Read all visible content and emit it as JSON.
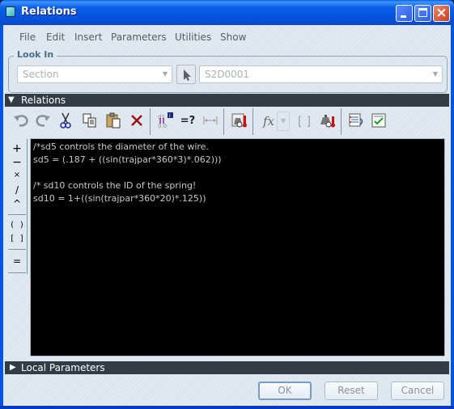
{
  "window": {
    "title": "Relations",
    "controls": {
      "minimize": "minimize",
      "maximize": "maximize",
      "close": "×"
    }
  },
  "menu": [
    "File",
    "Edit",
    "Insert",
    "Parameters",
    "Utilities",
    "Show"
  ],
  "look_in": {
    "label": "Look In",
    "type_value": "Section",
    "object_value": "S2D0001"
  },
  "relations_section": {
    "label": "Relations",
    "expanded": true
  },
  "toolbar": {
    "tools": [
      "undo",
      "redo",
      "cut",
      "copy",
      "paste",
      "delete",
      "sort-relations",
      "evaluate",
      "show-dimension",
      "verify-relations",
      "insert-function",
      "insert-parentheses",
      "unit-sensitive",
      "execute-relations",
      "verify"
    ],
    "function_glyph": "fx",
    "evaluate_glyph": "=?"
  },
  "operators": [
    "+",
    "−",
    "×",
    "/",
    "^",
    "( )",
    "[ ]",
    "="
  ],
  "editor": {
    "lines": [
      "/*sd5 controls the diameter of the wire.",
      "sd5 = (.187 + ((sin(trajpar*360*3)*.062)))",
      "",
      "/* sd10 controls the ID of the spring!",
      "sd10 = 1+((sin(trajpar*360*20)*.125))"
    ]
  },
  "local_parameters_section": {
    "label": "Local Parameters",
    "expanded": false
  },
  "buttons": {
    "ok": "OK",
    "reset": "Reset",
    "cancel": "Cancel"
  }
}
